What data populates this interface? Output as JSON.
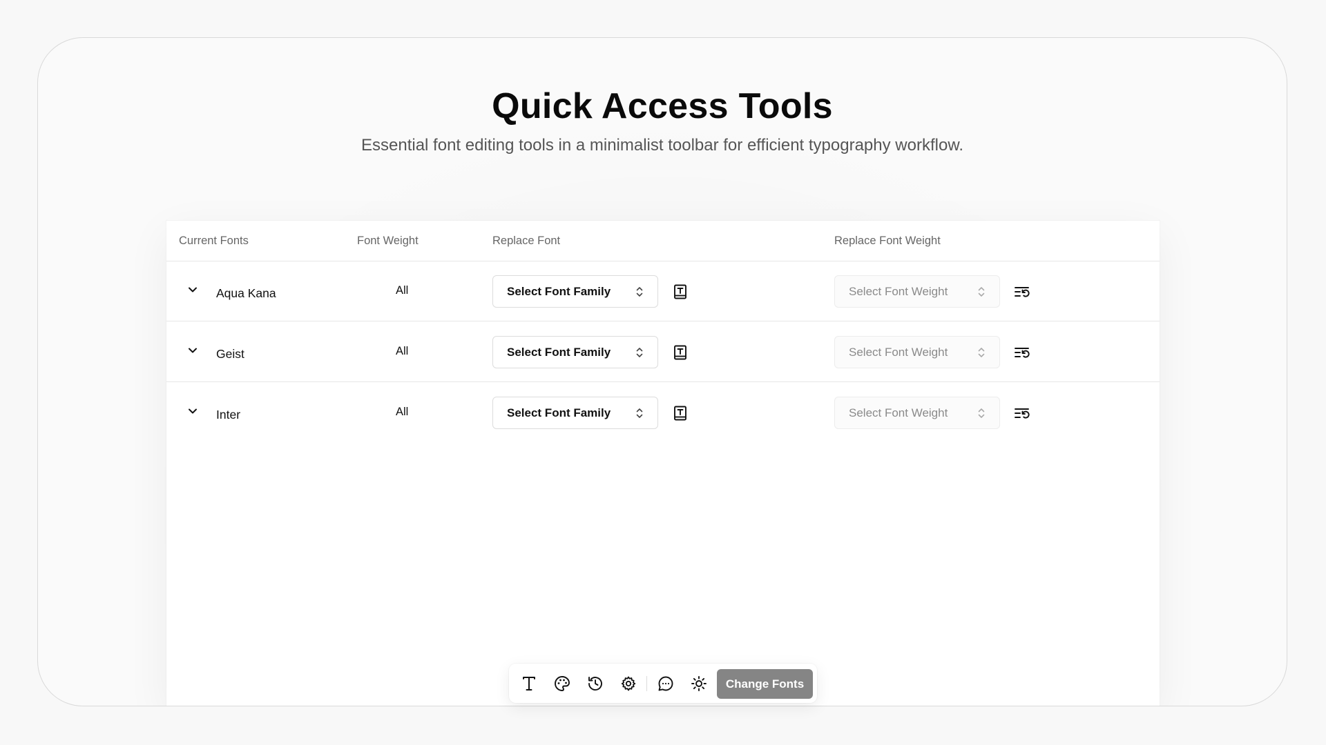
{
  "header": {
    "title": "Quick Access Tools",
    "subtitle": "Essential font editing tools in a minimalist toolbar for efficient typography workflow."
  },
  "table": {
    "columns": {
      "current_fonts": "Current Fonts",
      "font_weight": "Font Weight",
      "replace_font": "Replace Font",
      "replace_font_weight": "Replace Font Weight"
    },
    "rows": [
      {
        "font": "Aqua Kana",
        "weight": "All",
        "family_placeholder": "Select Font Family",
        "weight_placeholder": "Select Font Weight",
        "weight_select_disabled": true
      },
      {
        "font": "Geist",
        "weight": "All",
        "family_placeholder": "Select Font Family",
        "weight_placeholder": "Select Font Weight",
        "weight_select_disabled": true
      },
      {
        "font": "Inter",
        "weight": "All",
        "family_placeholder": "Select Font Family",
        "weight_placeholder": "Select Font Weight",
        "weight_select_disabled": true
      }
    ],
    "row_icons": {
      "expand": "chevron-down-icon",
      "preview": "book-type-icon",
      "reset": "list-reset-icon"
    }
  },
  "toolbar": {
    "tools": [
      {
        "name": "text",
        "icon": "type-icon"
      },
      {
        "name": "palette",
        "icon": "palette-icon"
      },
      {
        "name": "history",
        "icon": "history-icon"
      },
      {
        "name": "settings",
        "icon": "gear-icon"
      },
      {
        "name": "comments",
        "icon": "message-circle-icon"
      },
      {
        "name": "theme",
        "icon": "sun-icon"
      }
    ],
    "primary_label": "Change Fonts"
  },
  "colors": {
    "page_bg": "#f8f8f8",
    "panel_bg": "#ffffff",
    "primary_button": "#858585",
    "muted_text": "#666666"
  }
}
